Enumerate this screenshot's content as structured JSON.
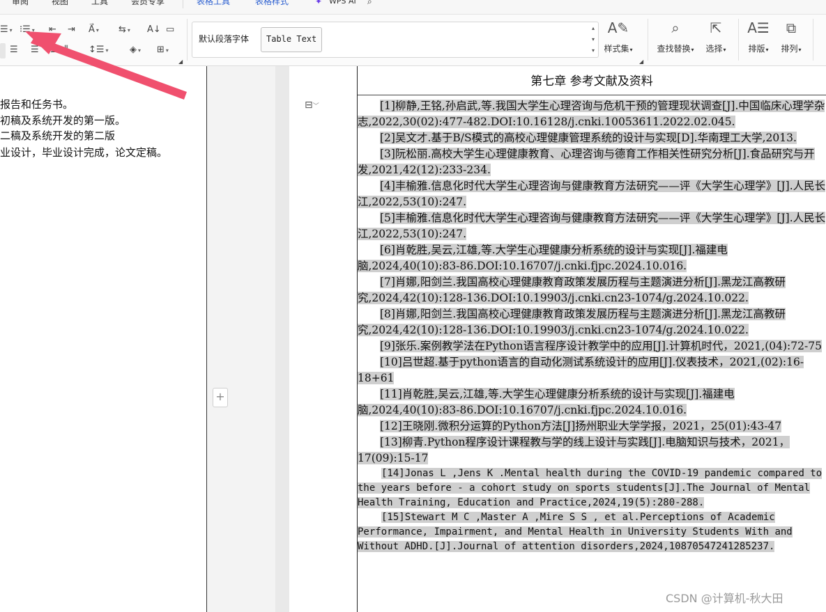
{
  "menu": {
    "items": [
      "审阅",
      "视图",
      "工具",
      "会员专享",
      "表格工具",
      "表格样式",
      "WPS AI"
    ]
  },
  "ribbon": {
    "style_gallery": {
      "default_style": "默认段落字体",
      "selected_style": "Table Text"
    },
    "buttons": {
      "styles": "样式集",
      "find_replace": "查找替换",
      "select": "选择",
      "layout": "排版",
      "arrange": "排列"
    }
  },
  "left_page": {
    "lines": [
      "报告和任务书。",
      "初稿及系统开发的第一版。",
      "二稿及系统开发的第二版",
      "业设计，毕业设计完成，论文定稿。"
    ]
  },
  "right_page": {
    "chapter_title": "第七章 参考文献及资料",
    "references": [
      "[1]柳静,王铭,孙启武,等.我国大学生心理咨询与危机干预的管理现状调查[J].中国临床心理学杂志,2022,30(02):477-482.DOI:10.16128/j.cnki.10053611.2022.02.045.",
      "[2]吴文才.基于B/S模式的高校心理健康管理系统的设计与实现[D].华南理工大学,2013.",
      "[3]阮松丽.高校大学生心理健康教育、心理咨询与德育工作相关性研究分析[J].食品研究与开发,2021,42(12):233-234.",
      "[4]丰榆雅.信息化时代大学生心理咨询与健康教育方法研究——评《大学生心理学》[J].人民长江,2022,53(10):247.",
      "[5]丰榆雅.信息化时代大学生心理咨询与健康教育方法研究——评《大学生心理学》[J].人民长江,2022,53(10):247.",
      "[6]肖乾胜,吴云,江雄,等.大学生心理健康分析系统的设计与实现[J].福建电脑,2024,40(10):83-86.DOI:10.16707/j.cnki.fjpc.2024.10.016.",
      "[7]肖娜,阳剑兰.我国高校心理健康教育政策发展历程与主题演进分析[J].黑龙江高教研究,2024,42(10):128-136.DOI:10.19903/j.cnki.cn23-1074/g.2024.10.022.",
      "[8]肖娜,阳剑兰.我国高校心理健康教育政策发展历程与主题演进分析[J].黑龙江高教研究,2024,42(10):128-136.DOI:10.19903/j.cnki.cn23-1074/g.2024.10.022.",
      "[9]张乐.案例教学法在Python语言程序设计教学中的应用[J].计算机时代，2021,(04):72-75",
      "[10]吕世超.基于python语言的自动化测试系统设计的应用[J].仪表技术，2021,(02):16-18+61",
      "[11]肖乾胜,吴云,江雄,等.大学生心理健康分析系统的设计与实现[J].福建电脑,2024,40(10):83-86.DOI:10.16707/j.cnki.fjpc.2024.10.016.",
      "[12]王晓刚.微积分运算的Python方法[J]扬州职业大学学报，2021，25(01):43-47",
      "[13]柳青.Python程序设计课程教与学的线上设计与实践[J].电脑知识与技术，2021，17(09):15-17",
      "[14]Jonas L ,Jens K .Mental health during the COVID-19 pandemic compared to the years before  - a cohort study on sports students[J].The Journal of Mental Health Training, Education and Practice,2024,19(5):280-288.",
      "[15]Stewart M C ,Master A ,Mire S S , et al.Perceptions of Academic Performance, Impairment, and Mental Health in University Students With and Without ADHD.[J].Journal of attention disorders,2024,10870547241285237."
    ]
  },
  "watermark": "CSDN @计算机-秋大田",
  "colors": {
    "highlight": "#cfcfcf",
    "arrow": "#f0506e",
    "tab_blue": "#2b5fd0"
  }
}
